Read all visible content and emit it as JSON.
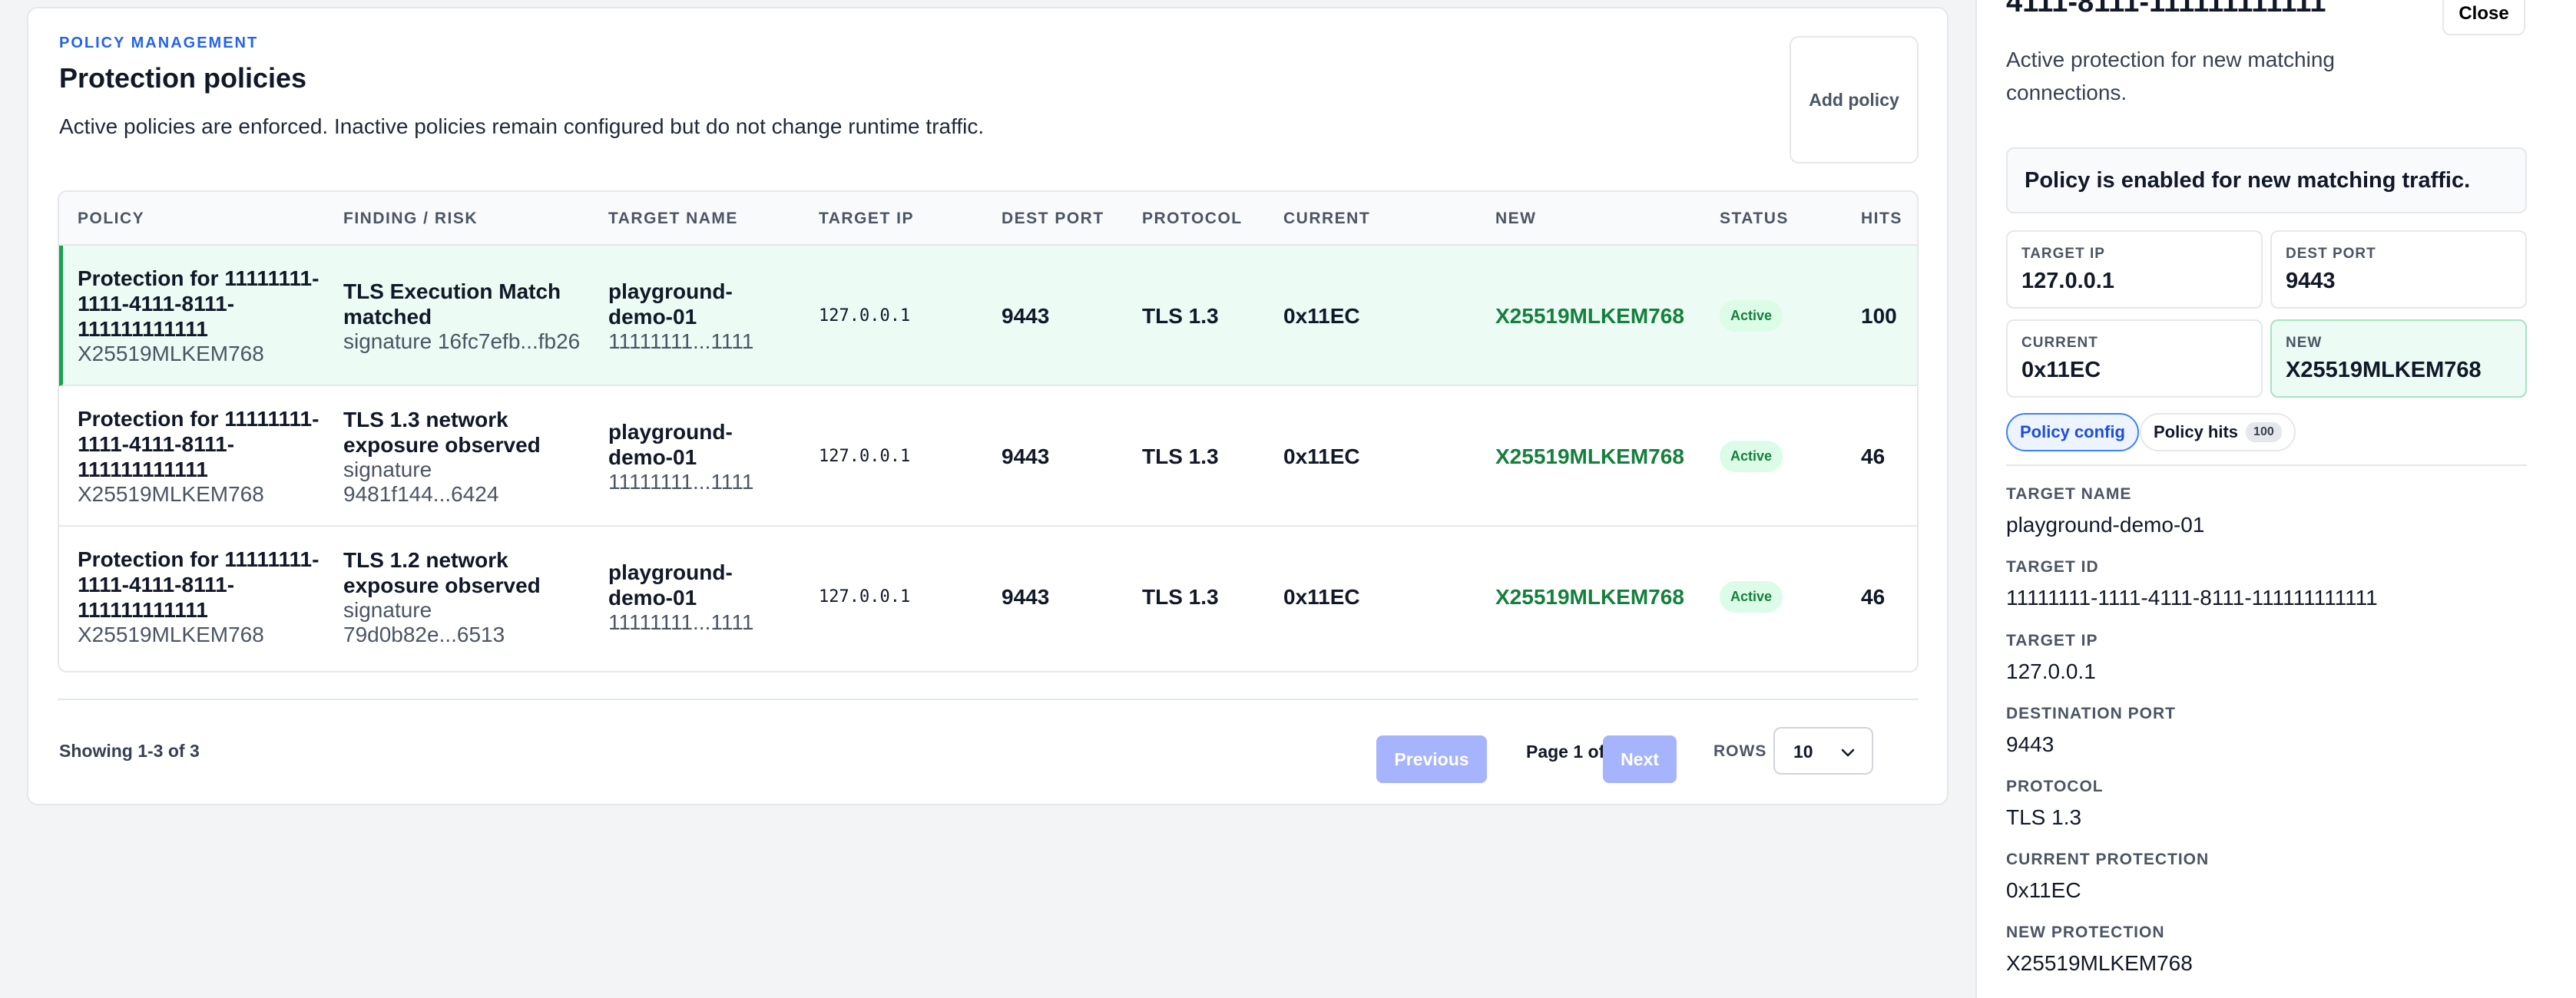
{
  "header": {
    "eyebrow": "POLICY MANAGEMENT",
    "title": "Protection policies",
    "description": "Active policies are enforced. Inactive policies remain configured but do not change runtime traffic.",
    "add_button": "Add policy"
  },
  "table": {
    "columns": [
      "POLICY",
      "FINDING / RISK",
      "TARGET NAME",
      "TARGET IP",
      "DEST PORT",
      "PROTOCOL",
      "CURRENT",
      "NEW",
      "STATUS",
      "HITS"
    ],
    "rows": [
      {
        "policy_lines": [
          "Protection for 11111111-",
          "1111-4111-8111-",
          "111111111111"
        ],
        "policy_sub": "X25519MLKEM768",
        "finding_lines": [
          "TLS Execution Match",
          "matched"
        ],
        "finding_sub_lines": [
          "signature 16fc7efb...fb26"
        ],
        "target_name_lines": [
          "playground-",
          "demo-01"
        ],
        "target_name_sub": "11111111...1111",
        "target_ip": "127.0.0.1",
        "dest_port": "9443",
        "protocol": "TLS 1.3",
        "current": "0x11EC",
        "new": "X25519MLKEM768",
        "status": "Active",
        "hits": "100"
      },
      {
        "policy_lines": [
          "Protection for 11111111-",
          "1111-4111-8111-",
          "111111111111"
        ],
        "policy_sub": "X25519MLKEM768",
        "finding_lines": [
          "TLS 1.3 network",
          "exposure observed"
        ],
        "finding_sub_lines": [
          "signature",
          "9481f144...6424"
        ],
        "target_name_lines": [
          "playground-",
          "demo-01"
        ],
        "target_name_sub": "11111111...1111",
        "target_ip": "127.0.0.1",
        "dest_port": "9443",
        "protocol": "TLS 1.3",
        "current": "0x11EC",
        "new": "X25519MLKEM768",
        "status": "Active",
        "hits": "46"
      },
      {
        "policy_lines": [
          "Protection for 11111111-",
          "1111-4111-8111-",
          "111111111111"
        ],
        "policy_sub": "X25519MLKEM768",
        "finding_lines": [
          "TLS 1.2 network",
          "exposure observed"
        ],
        "finding_sub_lines": [
          "signature",
          "79d0b82e...6513"
        ],
        "target_name_lines": [
          "playground-",
          "demo-01"
        ],
        "target_name_sub": "11111111...1111",
        "target_ip": "127.0.0.1",
        "dest_port": "9443",
        "protocol": "TLS 1.3",
        "current": "0x11EC",
        "new": "X25519MLKEM768",
        "status": "Active",
        "hits": "46"
      }
    ]
  },
  "pagination": {
    "showing": "Showing 1-3 of 3",
    "previous": "Previous",
    "page_of": "Page 1 of 1",
    "next": "Next",
    "rows_label": "ROWS",
    "rows_value": "10"
  },
  "panel": {
    "id_text": "4111-8111-111111111111",
    "close": "Close",
    "description": "Active protection for new matching connections.",
    "enabled_note": "Policy is enabled for new matching traffic.",
    "stats": [
      {
        "label": "TARGET IP",
        "value": "127.0.0.1"
      },
      {
        "label": "DEST PORT",
        "value": "9443"
      },
      {
        "label": "CURRENT",
        "value": "0x11EC"
      },
      {
        "label": "NEW",
        "value": "X25519MLKEM768"
      }
    ],
    "tabs": {
      "config": "Policy config",
      "hits": "Policy hits",
      "hits_count": "100"
    },
    "details": [
      {
        "label": "TARGET NAME",
        "value": "playground-demo-01"
      },
      {
        "label": "TARGET ID",
        "value": "11111111-1111-4111-8111-111111111111"
      },
      {
        "label": "TARGET IP",
        "value": "127.0.0.1"
      },
      {
        "label": "DESTINATION PORT",
        "value": "9443"
      },
      {
        "label": "PROTOCOL",
        "value": "TLS 1.3"
      },
      {
        "label": "CURRENT PROTECTION",
        "value": "0x11EC"
      },
      {
        "label": "NEW PROTECTION",
        "value": "X25519MLKEM768"
      }
    ]
  },
  "colors": {
    "accent": "#2563eb",
    "active_green": "#15803d",
    "selected_row_bg": "#ecfbf4",
    "pagination_button": "#a5b4fc"
  }
}
